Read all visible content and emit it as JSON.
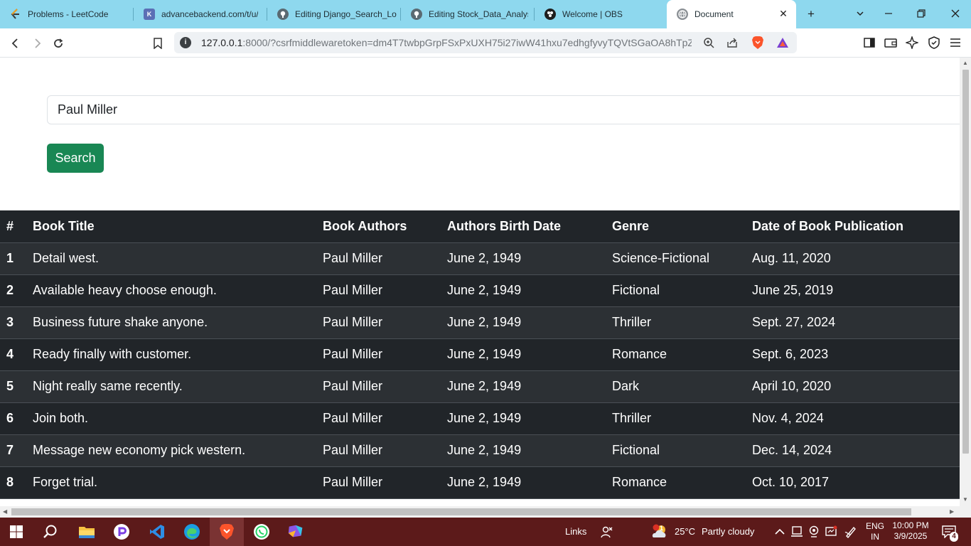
{
  "browser": {
    "tabs": [
      {
        "title": "Problems - LeetCode",
        "icon": "leetcode-icon"
      },
      {
        "title": "advancebackend.com/t/u/",
        "icon": "site-icon"
      },
      {
        "title": "Editing Django_Search_Lo",
        "icon": "github-icon"
      },
      {
        "title": "Editing Stock_Data_Analys",
        "icon": "github-icon"
      },
      {
        "title": "Welcome | OBS",
        "icon": "obs-icon"
      },
      {
        "title": "Document",
        "icon": "globe-icon"
      }
    ],
    "url_host": "127.0.0.1",
    "url_rest": ":8000/?csrfmiddlewaretoken=dm4T7twbpGrpFSxPxUXH75i27iwW41hxu7edhgfyvyTQVtSGaOA8hTpZo..."
  },
  "search": {
    "value": "Paul Miller",
    "button_label": "Search"
  },
  "table": {
    "headers": [
      "#",
      "Book Title",
      "Book Authors",
      "Authors Birth Date",
      "Genre",
      "Date of Book Publication"
    ],
    "rows": [
      [
        "1",
        "Detail west.",
        "Paul Miller",
        "June 2, 1949",
        "Science-Fictional",
        "Aug. 11, 2020"
      ],
      [
        "2",
        "Available heavy choose enough.",
        "Paul Miller",
        "June 2, 1949",
        "Fictional",
        "June 25, 2019"
      ],
      [
        "3",
        "Business future shake anyone.",
        "Paul Miller",
        "June 2, 1949",
        "Thriller",
        "Sept. 27, 2024"
      ],
      [
        "4",
        "Ready finally with customer.",
        "Paul Miller",
        "June 2, 1949",
        "Romance",
        "Sept. 6, 2023"
      ],
      [
        "5",
        "Night really same recently.",
        "Paul Miller",
        "June 2, 1949",
        "Dark",
        "April 10, 2020"
      ],
      [
        "6",
        "Join both.",
        "Paul Miller",
        "June 2, 1949",
        "Thriller",
        "Nov. 4, 2024"
      ],
      [
        "7",
        "Message new economy pick western.",
        "Paul Miller",
        "June 2, 1949",
        "Fictional",
        "Dec. 14, 2024"
      ],
      [
        "8",
        "Forget trial.",
        "Paul Miller",
        "June 2, 1949",
        "Romance",
        "Oct. 10, 2017"
      ]
    ]
  },
  "taskbar": {
    "links_label": "Links",
    "temperature": "25°C",
    "weather": "Partly cloudy",
    "weather_badge": "1",
    "language": "ENG",
    "region": "IN",
    "time": "10:00 PM",
    "date": "3/9/2025",
    "notification_count": "4"
  },
  "colors": {
    "tabstrip": "#8ed8ee",
    "search_button": "#198754",
    "table_dark": "#212529",
    "table_stripe": "#2c3034",
    "taskbar": "#5c1a1a"
  }
}
